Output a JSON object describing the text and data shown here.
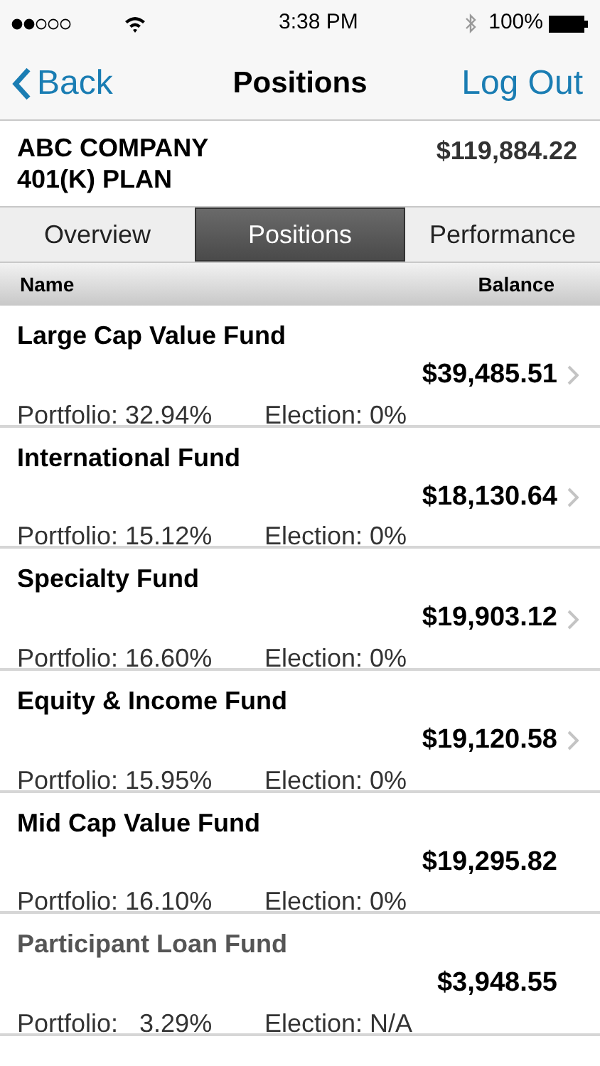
{
  "status_bar": {
    "time": "3:38 PM",
    "battery": "100%"
  },
  "nav": {
    "back": "Back",
    "title": "Positions",
    "action": "Log Out"
  },
  "plan": {
    "name": "ABC COMPANY\n401(K) PLAN",
    "balance": "$119,884.22"
  },
  "tabs": [
    {
      "label": "Overview",
      "selected": false
    },
    {
      "label": "Positions",
      "selected": true
    },
    {
      "label": "Performance",
      "selected": false
    }
  ],
  "columns": [
    "Name",
    "Balance"
  ],
  "rows": [
    {
      "name": "Large Cap Value Fund",
      "balance": "$39,485.51",
      "portfolio": "Portfolio: 32.94%",
      "election": "Election: 0%",
      "has_detail": true,
      "disabled": false
    },
    {
      "name": "International Fund",
      "balance": "$18,130.64",
      "portfolio": "Portfolio: 15.12%",
      "election": "Election: 0%",
      "has_detail": true,
      "disabled": false
    },
    {
      "name": "Specialty Fund",
      "balance": "$19,903.12",
      "portfolio": "Portfolio: 16.60%",
      "election": "Election: 0%",
      "has_detail": true,
      "disabled": false
    },
    {
      "name": "Equity & Income Fund",
      "balance": "$19,120.58",
      "portfolio": "Portfolio: 15.95%",
      "election": "Election: 0%",
      "has_detail": true,
      "disabled": false
    },
    {
      "name": "Mid Cap Value Fund",
      "balance": "$19,295.82",
      "portfolio": "Portfolio: 16.10%",
      "election": "Election: 0%",
      "has_detail": false,
      "disabled": false
    },
    {
      "name": "Participant Loan Fund",
      "balance": "$3,948.55",
      "portfolio": "Portfolio:   3.29%",
      "election": "Election: N/A",
      "has_detail": false,
      "disabled": true
    }
  ]
}
